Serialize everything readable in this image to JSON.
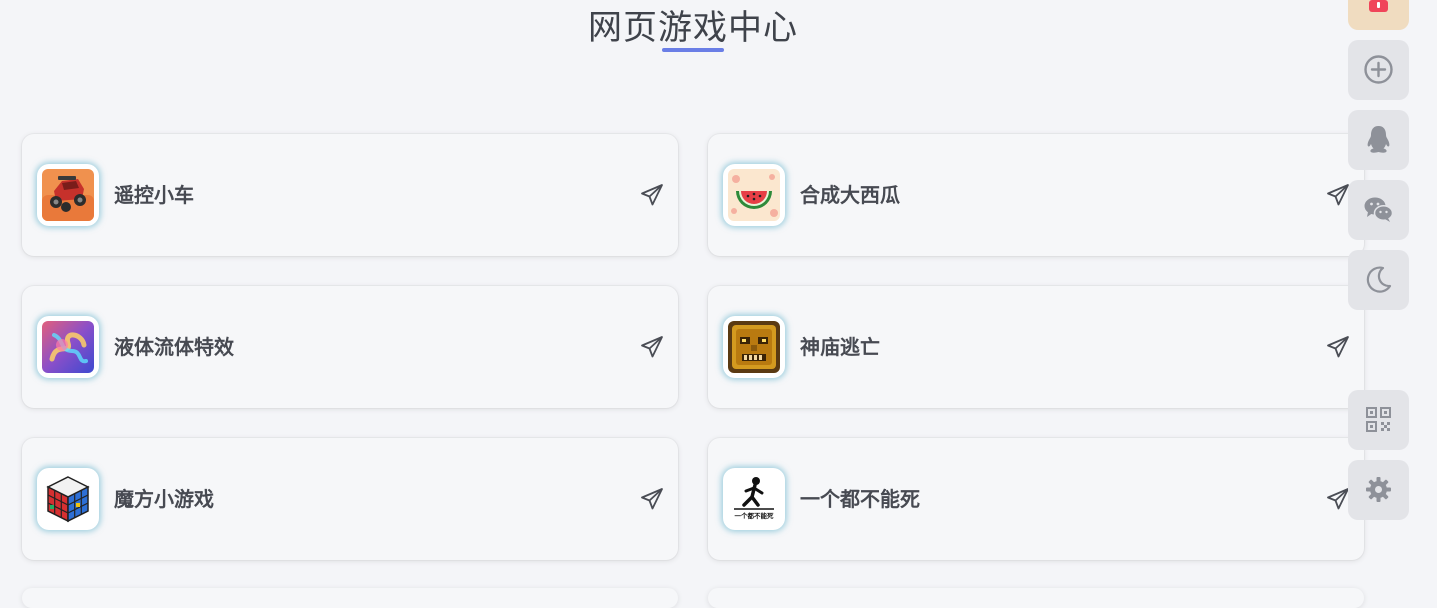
{
  "header": {
    "title": "网页游戏中心",
    "accent_color": "#6a7ee6"
  },
  "games": [
    {
      "name": "遥控小车",
      "icon": "rc-car-icon"
    },
    {
      "name": "合成大西瓜",
      "icon": "watermelon-icon"
    },
    {
      "name": "液体流体特效",
      "icon": "fluid-effect-icon"
    },
    {
      "name": "神庙逃亡",
      "icon": "temple-run-icon"
    },
    {
      "name": "魔方小游戏",
      "icon": "rubiks-cube-icon"
    },
    {
      "name": "一个都不能死",
      "icon": "stickman-runner-icon",
      "icon_text": "一个都不能死"
    }
  ],
  "sidebar": {
    "buttons": [
      {
        "icon": "gift-icon"
      },
      {
        "icon": "plus-circle-icon"
      },
      {
        "icon": "qq-icon"
      },
      {
        "icon": "wechat-icon"
      },
      {
        "icon": "moon-icon"
      },
      {
        "icon": "qrcode-icon"
      },
      {
        "icon": "gear-icon"
      }
    ]
  }
}
